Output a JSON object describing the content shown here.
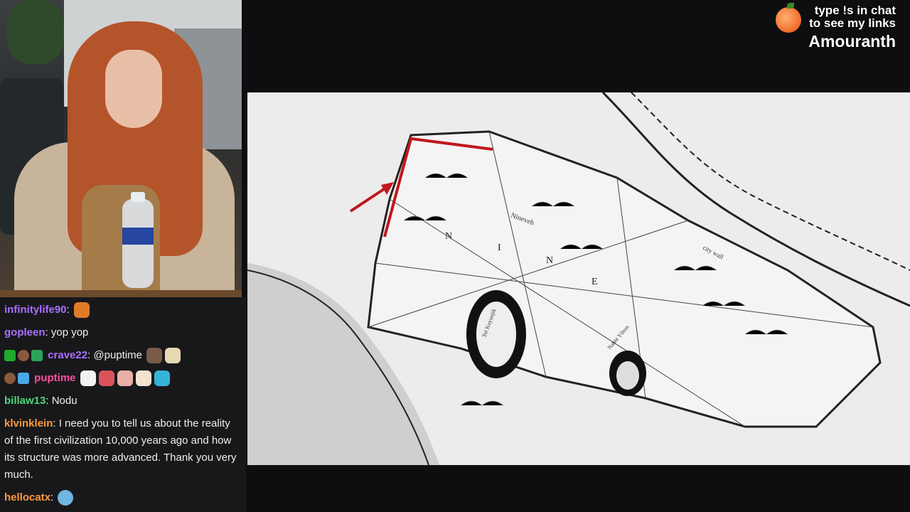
{
  "overlay": {
    "line1": "type !s in chat",
    "line2": "to see my links",
    "streamer_name": "Amouranth"
  },
  "chat": {
    "messages": [
      {
        "user": "infinitylife90",
        "color": "#a970ff",
        "text": "",
        "emotes": [
          "fox-emote"
        ]
      },
      {
        "user": "gopleen",
        "color": "#a970ff",
        "text": "yop yop",
        "emotes": []
      },
      {
        "user": "crave22",
        "color": "#a970ff",
        "text": "@puptime",
        "emotes": [
          "dog-emote",
          "dog-emote"
        ]
      },
      {
        "user": "puptime",
        "color": "#ff4fa0",
        "text": "",
        "emotes": [
          "cat-emote",
          "cat-emote",
          "cat-emote",
          "cat-emote",
          "cat-emote"
        ]
      },
      {
        "user": "billaw13",
        "color": "#4fd67b",
        "text": "Nodu",
        "emotes": []
      },
      {
        "user": "klvinklein",
        "color": "#ff9a3c",
        "text": "I need you to tell us about the reality of the first civilization 10,000 years ago and how its structure was more advanced. Thank you very much.",
        "emotes": []
      },
      {
        "user": "hellocatx",
        "color": "#ff9a3c",
        "text": "",
        "emotes": [
          "blob-emote"
        ]
      }
    ]
  },
  "map": {
    "labels": {
      "letter_n1": "N",
      "letter_i": "I",
      "letter_n2": "N",
      "letter_e": "E",
      "nineveh": "Nineveh",
      "city_wall": "city wall",
      "nabi_yunus": "Nabbi Yûnus",
      "tel_kuyunjik": "Tel Kuyunjik"
    },
    "annotation_color": "#c0181c"
  }
}
